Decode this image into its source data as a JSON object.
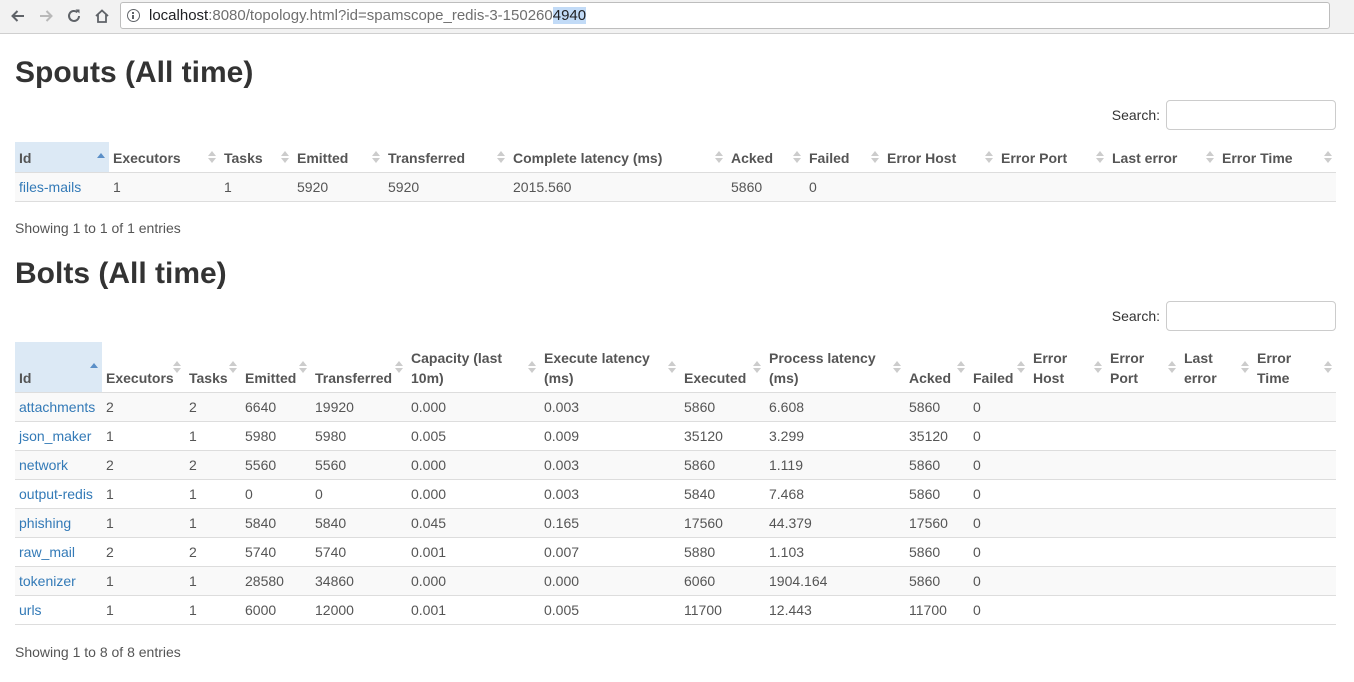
{
  "browser": {
    "url_host": "localhost",
    "url_rest": ":8080/topology.html?id=spamscope_redis-3-150260",
    "url_selected": "4940"
  },
  "spouts": {
    "title": "Spouts (All time)",
    "search_label": "Search:",
    "search_value": "",
    "columns": [
      "Id",
      "Executors",
      "Tasks",
      "Emitted",
      "Transferred",
      "Complete latency (ms)",
      "Acked",
      "Failed",
      "Error Host",
      "Error Port",
      "Last error",
      "Error Time"
    ],
    "rows": [
      [
        "files-mails",
        "1",
        "1",
        "5920",
        "5920",
        "2015.560",
        "5860",
        "0",
        "",
        "",
        "",
        ""
      ]
    ],
    "info": "Showing 1 to 1 of 1 entries"
  },
  "bolts": {
    "title": "Bolts (All time)",
    "search_label": "Search:",
    "search_value": "",
    "columns": [
      "Id",
      "Executors",
      "Tasks",
      "Emitted",
      "Transferred",
      "Capacity (last 10m)",
      "Execute latency (ms)",
      "Executed",
      "Process latency (ms)",
      "Acked",
      "Failed",
      "Error Host",
      "Error Port",
      "Last error",
      "Error Time"
    ],
    "rows": [
      [
        "attachments",
        "2",
        "2",
        "6640",
        "19920",
        "0.000",
        "0.003",
        "5860",
        "6.608",
        "5860",
        "0",
        "",
        "",
        "",
        ""
      ],
      [
        "json_maker",
        "1",
        "1",
        "5980",
        "5980",
        "0.005",
        "0.009",
        "35120",
        "3.299",
        "35120",
        "0",
        "",
        "",
        "",
        ""
      ],
      [
        "network",
        "2",
        "2",
        "5560",
        "5560",
        "0.000",
        "0.003",
        "5860",
        "1.119",
        "5860",
        "0",
        "",
        "",
        "",
        ""
      ],
      [
        "output-redis",
        "1",
        "1",
        "0",
        "0",
        "0.000",
        "0.003",
        "5840",
        "7.468",
        "5860",
        "0",
        "",
        "",
        "",
        ""
      ],
      [
        "phishing",
        "1",
        "1",
        "5840",
        "5840",
        "0.045",
        "0.165",
        "17560",
        "44.379",
        "17560",
        "0",
        "",
        "",
        "",
        ""
      ],
      [
        "raw_mail",
        "2",
        "2",
        "5740",
        "5740",
        "0.001",
        "0.007",
        "5880",
        "1.103",
        "5860",
        "0",
        "",
        "",
        "",
        ""
      ],
      [
        "tokenizer",
        "1",
        "1",
        "28580",
        "34860",
        "0.000",
        "0.000",
        "6060",
        "1904.164",
        "5860",
        "0",
        "",
        "",
        "",
        ""
      ],
      [
        "urls",
        "1",
        "1",
        "6000",
        "12000",
        "0.001",
        "0.005",
        "11700",
        "12.443",
        "11700",
        "0",
        "",
        "",
        "",
        ""
      ]
    ],
    "info": "Showing 1 to 8 of 8 entries"
  }
}
